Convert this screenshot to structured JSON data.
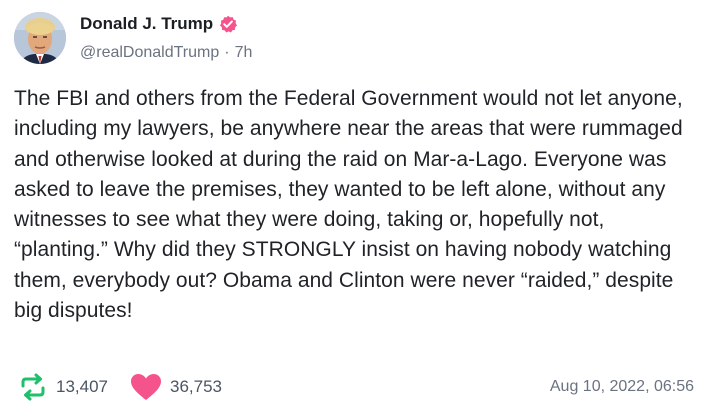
{
  "author": {
    "display_name": "Donald J. Trump",
    "handle": "@realDonaldTrump",
    "separator": "·",
    "relative_time": "7h",
    "verified": true
  },
  "post": {
    "text": "The FBI and others from the Federal Government would not let anyone, including my lawyers, be anywhere near the areas that were rummaged and otherwise looked at during the raid on Mar-a-Lago. Everyone was asked to leave the premises, they wanted to be left alone, without any witnesses to see what they were doing, taking or, hopefully not, “planting.” Why did they STRONGLY insist on having nobody watching them, everybody out? Obama and Clinton were never “raided,” despite big disputes!"
  },
  "stats": {
    "reposts": "13,407",
    "likes": "36,753",
    "timestamp": "Aug 10, 2022, 06:56"
  },
  "colors": {
    "verified_badge": "#f5538b",
    "repost_icon": "#1fbf6b",
    "like_icon": "#f5538b",
    "text": "#1f2328",
    "muted": "#6b7280"
  },
  "icons": {
    "avatar": "avatar",
    "verified": "verified-badge-icon",
    "repost": "repost-icon",
    "like": "heart-icon"
  }
}
